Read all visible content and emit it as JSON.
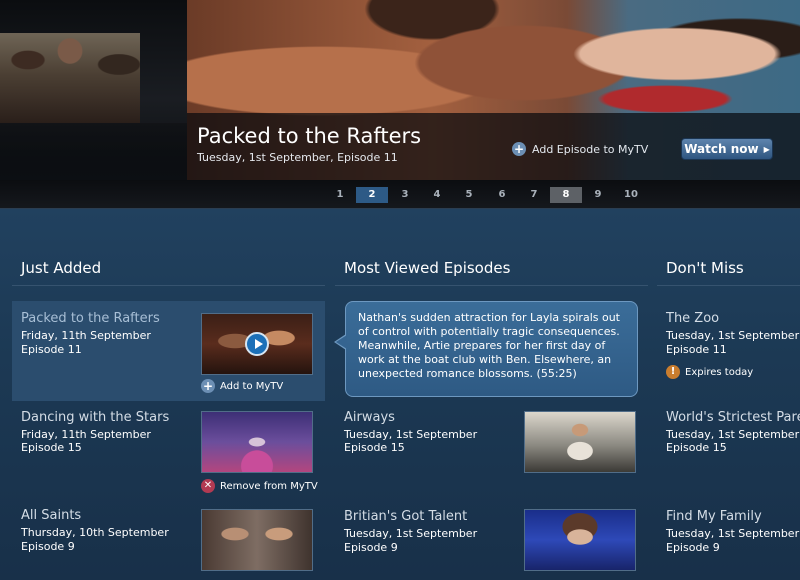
{
  "hero": {
    "title": "Packed to the Rafters",
    "subtitle": "Tuesday, 1st September, Episode 11",
    "add_label": "Add Episode to MyTV",
    "watch_label": "Watch now"
  },
  "pagination": {
    "pages": [
      "1",
      "2",
      "3",
      "4",
      "5",
      "6",
      "7",
      "8",
      "9",
      "10"
    ],
    "active": "2",
    "marked": "8"
  },
  "columns": {
    "just_added": {
      "title": "Just Added",
      "items": [
        {
          "title": "Packed to the Rafters",
          "date": "Friday, 11th September",
          "episode": "Episode 11",
          "action": "Add to MyTV"
        },
        {
          "title": "Dancing with the Stars",
          "date": "Friday, 11th September",
          "episode": "Episode 15",
          "action": "Remove from MyTV"
        },
        {
          "title": "All Saints",
          "date": "Thursday, 10th September",
          "episode": "Episode 9"
        }
      ]
    },
    "most_viewed": {
      "title": "Most Viewed Episodes",
      "tooltip": "Nathan's sudden attraction for Layla spirals out of control with potentially tragic consequences. Meanwhile, Artie prepares for her first day of work at the boat club with Ben. Elsewhere, an unexpected romance blossoms. (55:25)",
      "items": [
        {
          "title": "Airways",
          "date": "Tuesday, 1st September",
          "episode": "Episode 15"
        },
        {
          "title": "Britian's Got Talent",
          "date": "Tuesday, 1st September",
          "episode": "Episode 9"
        }
      ]
    },
    "dont_miss": {
      "title": "Don't Miss",
      "items": [
        {
          "title": "The Zoo",
          "date": "Tuesday, 1st September",
          "episode": "Episode 11",
          "badge": "Expires today"
        },
        {
          "title": "World's Strictest Pare",
          "date": "Tuesday, 1st September",
          "episode": "Episode 15"
        },
        {
          "title": "Find My Family",
          "date": "Tuesday, 1st September",
          "episode": "Episode 9"
        }
      ]
    }
  },
  "icons": {
    "add": "plus-circle-icon",
    "remove": "x-circle-icon",
    "warning": "exclamation-circle-icon",
    "play": "play-icon",
    "arrow": "chevron-right-icon"
  },
  "colors": {
    "accent": "#2d5a86",
    "background": "#1c3954",
    "highlight": "#2b4d6e",
    "remove": "#b23a52",
    "warning": "#c97d2e"
  }
}
